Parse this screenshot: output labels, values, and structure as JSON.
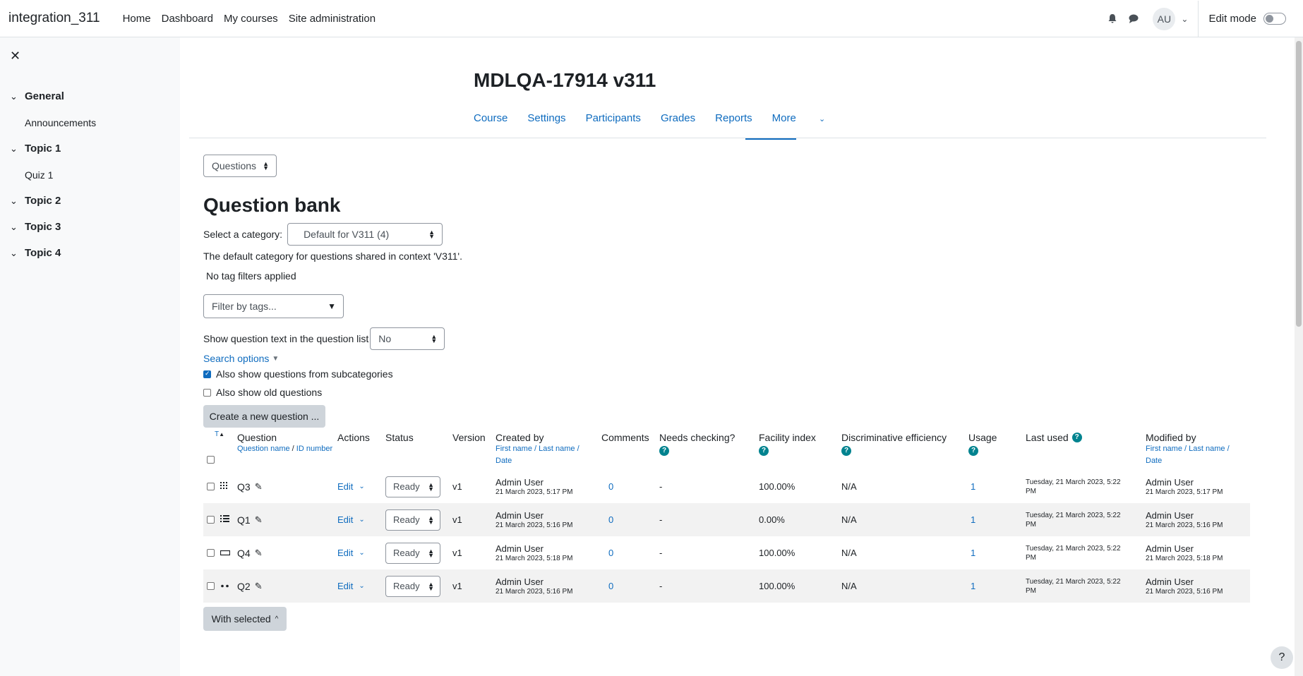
{
  "navbar": {
    "brand": "integration_311",
    "items": [
      "Home",
      "Dashboard",
      "My courses",
      "Site administration"
    ],
    "avatar_initials": "AU",
    "edit_mode_label": "Edit mode"
  },
  "drawer": {
    "sections": [
      {
        "label": "General",
        "activities": [
          "Announcements"
        ]
      },
      {
        "label": "Topic 1",
        "activities": [
          "Quiz 1"
        ]
      },
      {
        "label": "Topic 2",
        "activities": []
      },
      {
        "label": "Topic 3",
        "activities": []
      },
      {
        "label": "Topic 4",
        "activities": []
      }
    ]
  },
  "course": {
    "title": "MDLQA-17914 v311",
    "nav": [
      "Course",
      "Settings",
      "Participants",
      "Grades",
      "Reports",
      "More"
    ]
  },
  "bank": {
    "page_select": "Questions",
    "heading": "Question bank",
    "category_label": "Select a category:",
    "category_value": "Default for V311 (4)",
    "category_desc": "The default category for questions shared in context 'V311'.",
    "no_tag_filters": "No tag filters applied",
    "tag_placeholder": "Filter by tags...",
    "show_text_label": "Show question text in the question list",
    "show_text_value": "No",
    "search_options": "Search options",
    "subcategories_label": "Also show questions from subcategories",
    "subcategories_checked": true,
    "old_questions_label": "Also show old questions",
    "old_questions_checked": false,
    "create_button": "Create a new question ...",
    "with_selected": "With selected"
  },
  "table": {
    "type_sort": "T",
    "headers": {
      "question": "Question",
      "question_sub_name": "Question name",
      "question_sub_sep": " / ",
      "question_sub_id": "ID number",
      "actions": "Actions",
      "status": "Status",
      "version": "Version",
      "created_by": "Created by",
      "comments": "Comments",
      "needs_checking": "Needs checking?",
      "facility": "Facility index",
      "discrimination": "Discriminative efficiency",
      "usage": "Usage",
      "last_used": "Last used",
      "modified_by": "Modified by",
      "person_sub_first": "First name",
      "person_sub_last": "Last name",
      "person_sub_date": "Date"
    },
    "rows": [
      {
        "name": "Q3",
        "type_icon": "drag-drop-icon",
        "action": "Edit",
        "status": "Ready",
        "version": "v1",
        "creator": "Admin User",
        "created": "21 March 2023, 5:17 PM",
        "comments": "0",
        "needs_checking": "-",
        "facility": "100.00%",
        "discrimination": "N/A",
        "usage": "1",
        "last_used": "Tuesday, 21 March 2023, 5:22 PM",
        "modifier": "Admin User",
        "modified": "21 March 2023, 5:17 PM"
      },
      {
        "name": "Q1",
        "type_icon": "multichoice-icon",
        "action": "Edit",
        "status": "Ready",
        "version": "v1",
        "creator": "Admin User",
        "created": "21 March 2023, 5:16 PM",
        "comments": "0",
        "needs_checking": "-",
        "facility": "0.00%",
        "discrimination": "N/A",
        "usage": "1",
        "last_used": "Tuesday, 21 March 2023, 5:22 PM",
        "modifier": "Admin User",
        "modified": "21 March 2023, 5:16 PM"
      },
      {
        "name": "Q4",
        "type_icon": "short-answer-icon",
        "action": "Edit",
        "status": "Ready",
        "version": "v1",
        "creator": "Admin User",
        "created": "21 March 2023, 5:18 PM",
        "comments": "0",
        "needs_checking": "-",
        "facility": "100.00%",
        "discrimination": "N/A",
        "usage": "1",
        "last_used": "Tuesday, 21 March 2023, 5:22 PM",
        "modifier": "Admin User",
        "modified": "21 March 2023, 5:18 PM"
      },
      {
        "name": "Q2",
        "type_icon": "true-false-icon",
        "action": "Edit",
        "status": "Ready",
        "version": "v1",
        "creator": "Admin User",
        "created": "21 March 2023, 5:16 PM",
        "comments": "0",
        "needs_checking": "-",
        "facility": "100.00%",
        "discrimination": "N/A",
        "usage": "1",
        "last_used": "Tuesday, 21 March 2023, 5:22 PM",
        "modifier": "Admin User",
        "modified": "21 March 2023, 5:16 PM"
      }
    ]
  },
  "footer_help": "?"
}
